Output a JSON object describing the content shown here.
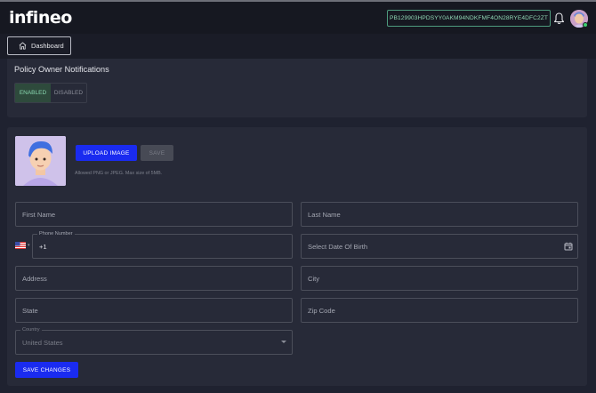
{
  "header": {
    "logo_text": "infineo",
    "policy_id": "PB129903HPDSYY0AKM94NDKFMF4ON28RYE4DFC2ZT",
    "bell_icon": "bell-icon",
    "avatar_icon": "user-avatar-icon",
    "accent_color": "#4e9b7e"
  },
  "subnav": {
    "dashboard_label": "Dashboard",
    "dashboard_icon": "home-icon"
  },
  "notifications": {
    "title": "Policy Owner Notifications",
    "enabled_label": "ENABLED",
    "disabled_label": "DISABLED",
    "selected": "ENABLED"
  },
  "profile": {
    "upload_label": "UPLOAD IMAGE",
    "save_label": "SAVE",
    "hint": "Allowed PNG or JPEG. Max size of 5MB.",
    "primary_color": "#1a2bf0"
  },
  "form": {
    "first_name_placeholder": "First Name",
    "last_name_placeholder": "Last Name",
    "phone_label": "Phone Number",
    "phone_value": "+1",
    "phone_country_icon": "us-flag-icon",
    "dob_placeholder": "Select Date Of Birth",
    "dob_icon": "calendar-icon",
    "address_placeholder": "Address",
    "city_placeholder": "City",
    "state_placeholder": "State",
    "zip_placeholder": "Zip Code",
    "country_label": "Country",
    "country_value": "United States",
    "submit_label": "SAVE CHANGES"
  }
}
